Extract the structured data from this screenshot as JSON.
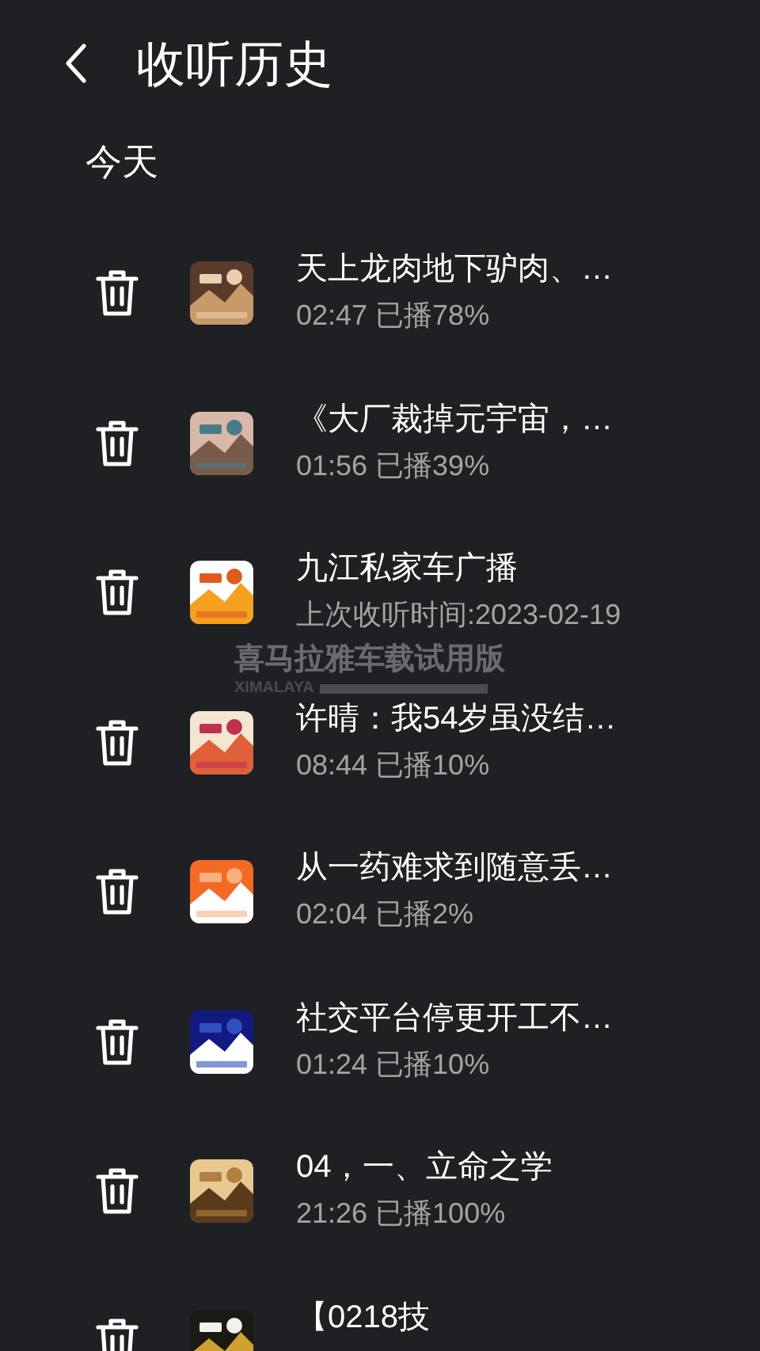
{
  "header": {
    "title": "收听历史"
  },
  "section": {
    "title": "今天"
  },
  "items": [
    {
      "title": "天上龙肉地下驴肉、…",
      "subtitle": "02:47 已播78%"
    },
    {
      "title": "《大厂裁掉元宇宙，…",
      "subtitle": "01:56 已播39%"
    },
    {
      "title": "九江私家车广播",
      "subtitle": "上次收听时间:2023-02-19"
    },
    {
      "title": "许晴：我54岁虽没结…",
      "subtitle": "08:44 已播10%"
    },
    {
      "title": "从一药难求到随意丢…",
      "subtitle": "02:04 已播2%"
    },
    {
      "title": "社交平台停更开工不…",
      "subtitle": "01:24 已播10%"
    },
    {
      "title": "04，一、立命之学",
      "subtitle": "21:26 已播100%"
    },
    {
      "title": "【0218技"
    }
  ],
  "trial_watermark": {
    "title": "喜马拉雅车载试用版",
    "brand": "XIMALAYA"
  }
}
